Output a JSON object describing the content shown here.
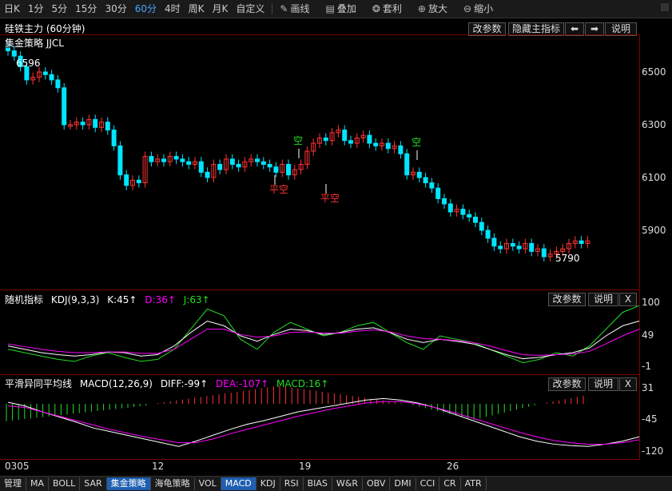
{
  "toolbar": {
    "periods": [
      "日K",
      "1分",
      "5分",
      "15分",
      "30分",
      "60分",
      "4时",
      "周K",
      "月K",
      "自定义"
    ],
    "active_period": "60分",
    "tools": [
      {
        "icon": "pencil-icon",
        "label": "画线"
      },
      {
        "icon": "layers-icon",
        "label": "叠加"
      },
      {
        "icon": "money-bag-icon",
        "label": "套利"
      },
      {
        "icon": "zoom-in-icon",
        "label": "放大"
      },
      {
        "icon": "zoom-out-icon",
        "label": "缩小"
      }
    ]
  },
  "main_panel": {
    "title": "硅铁主力 (60分钟)",
    "strategy": "集金策略 JJCL",
    "buttons": {
      "params": "改参数",
      "hide": "隐藏主指标",
      "prev": "⬅",
      "next": "➡",
      "help": "说明"
    },
    "y_ticks": [
      "6500",
      "6300",
      "6100",
      "5900"
    ],
    "high_label": "6596",
    "low_label": "5790",
    "signals": [
      {
        "text": "空",
        "color": "#22dd22"
      },
      {
        "text": "平空",
        "color": "#ff3333"
      },
      {
        "text": "平空",
        "color": "#ff3333"
      },
      {
        "text": "空",
        "color": "#22dd22"
      }
    ]
  },
  "kdj_panel": {
    "name": "随机指标",
    "params": "KDJ(9,3,3)",
    "k": "K:45↑",
    "d": "D:36↑",
    "j": "J:63↑",
    "buttons": {
      "params": "改参数",
      "help": "说明",
      "close": "X"
    },
    "y_ticks": [
      "100",
      "49",
      "-1"
    ]
  },
  "macd_panel": {
    "name": "平滑异同平均线",
    "params": "MACD(12,26,9)",
    "diff": "DIFF:-99↑",
    "dea": "DEA:-107↑",
    "macd": "MACD:16↑",
    "buttons": {
      "params": "改参数",
      "help": "说明",
      "close": "X"
    },
    "y_ticks": [
      "31",
      "-45",
      "-120"
    ]
  },
  "x_axis": [
    "0305",
    "12",
    "19",
    "26"
  ],
  "bottom_tabs": [
    "管理",
    "MA",
    "BOLL",
    "SAR",
    "集金策略",
    "海龟策略",
    "VOL",
    "MACD",
    "KDJ",
    "RSI",
    "BIAS",
    "W&R",
    "OBV",
    "DMI",
    "CCI",
    "CR",
    "ATR"
  ],
  "active_tabs": [
    "集金策略",
    "MACD"
  ],
  "colors": {
    "up": "#ff3333",
    "down": "#00e5ff",
    "grid": "#7a0000",
    "kdj_k": "#ffffff",
    "kdj_d": "#ff00ff",
    "kdj_j": "#22dd22",
    "macd_dea": "#ff00ff",
    "macd_diff": "#ffffff"
  }
}
